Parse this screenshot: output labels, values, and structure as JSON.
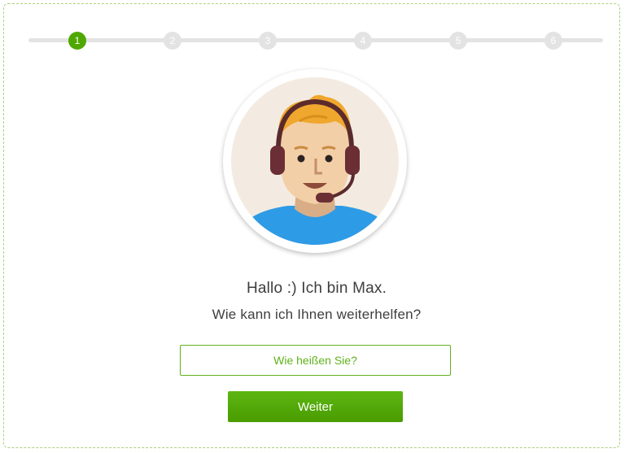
{
  "colors": {
    "accent": "#4fa800",
    "step_inactive": "#e3e3e3",
    "card_border": "#a9d37c",
    "text": "#3e3e3e"
  },
  "progress": {
    "current_step": 1,
    "steps": [
      "1",
      "2",
      "3",
      "4",
      "5",
      "6"
    ]
  },
  "avatar": {
    "icon": "support-agent-headset-icon"
  },
  "greeting": "Hallo :) Ich bin Max.",
  "question": "Wie kann ich Ihnen weiterhelfen?",
  "name_input": {
    "placeholder": "Wie heißen Sie?",
    "value": ""
  },
  "next_button": {
    "label": "Weiter"
  }
}
